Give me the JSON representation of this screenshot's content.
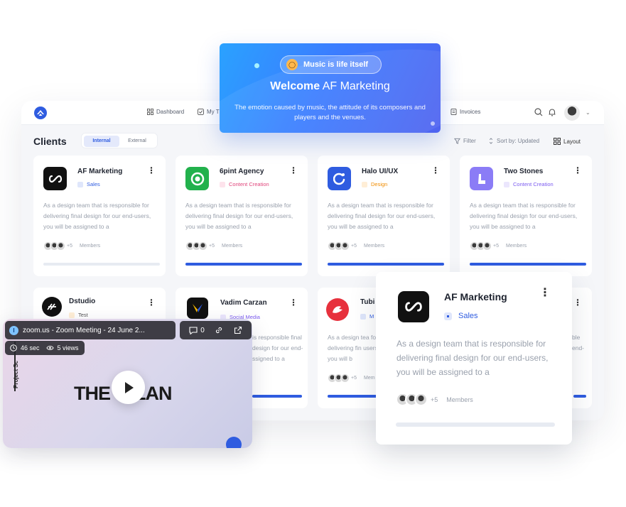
{
  "banner": {
    "pill_label": "Music is life itself",
    "title_bold": "Welcome",
    "title_rest": "AF Marketing",
    "subtitle": "The emotion caused by music, the attitude of its composers and players and the venues."
  },
  "topbar": {
    "nav": [
      "Dashboard",
      "My T",
      "Invoices"
    ],
    "icons": [
      "search-icon",
      "bell-icon"
    ]
  },
  "clients": {
    "title": "Clients",
    "segments": [
      "Internal",
      "External"
    ],
    "active_segment": "Internal",
    "filter_label": "Filter",
    "sort_label": "Sort by: Updated",
    "layout_label": "Layout"
  },
  "cards": [
    {
      "name": "AF Marketing",
      "tag": "Sales",
      "tag_color": "#2f5ce0",
      "icon_bg": "#111111",
      "desc": "As a design team that is responsible for delivering final design for our end-users, you will be assigned to a",
      "members_extra": "+5",
      "members_label": "Members",
      "progress": 0.0
    },
    {
      "name": "6pint Agency",
      "tag": "Content Creation",
      "tag_color": "#e0457b",
      "icon_bg": "#22b14c",
      "desc": "As a design team that is responsible for delivering final design for our end-users, you will be assigned to a",
      "members_extra": "+5",
      "members_label": "Members",
      "progress": 1.0
    },
    {
      "name": "Halo UI/UX",
      "tag": "Design",
      "tag_color": "#f08c00",
      "icon_bg": "#2f5ce0",
      "desc": "As a design team that is responsible for delivering final design for our end-users, you will be assigned to a",
      "members_extra": "+5",
      "members_label": "Members",
      "progress": 1.0
    },
    {
      "name": "Two Stones",
      "tag": "Content Creation",
      "tag_color": "#7c5cf0",
      "icon_bg": "#8b7cf6",
      "desc": "As a design team that is responsible for delivering final design for our end-users, you will be assigned to a",
      "members_extra": "+5",
      "members_label": "Members",
      "progress": 1.0
    },
    {
      "name": "Dstudio",
      "tag": "Test",
      "tag_color": "#f08c00",
      "icon_bg": "#111111",
      "desc": "",
      "members_extra": "",
      "members_label": "",
      "progress": 0.0
    },
    {
      "name": "Vadim Carzan",
      "tag": "Social Media",
      "tag_color": "#7c5cf0",
      "icon_bg": "#111111",
      "desc": "is responsible final design for our end-ssigned to a",
      "members_extra": "",
      "members_label": "",
      "progress": 1.0
    },
    {
      "name": "Tubi",
      "tag": "M",
      "tag_color": "#2f5ce0",
      "icon_bg": "#ffffff",
      "desc": "As a design tea for delivering fin users, you will b",
      "members_extra": "+5",
      "members_label": "Mem",
      "progress": 1.0
    },
    {
      "name": "",
      "tag": "",
      "tag_color": "#2f5ce0",
      "icon_bg": "#ffffff",
      "desc": "ble end-",
      "members_extra": "",
      "members_label": "",
      "progress": 1.0
    }
  ],
  "zoom": {
    "title": "zoom.us - Zoom Meeting - 24 June 2...",
    "comments": "0",
    "duration": "46 sec",
    "views": "5 views",
    "side_label": "Project Sc",
    "video_text_left": "THE",
    "video_text_right": "LAN"
  },
  "bigcard": {
    "name": "AF Marketing",
    "tag": "Sales",
    "desc": "As a design team that is responsible for delivering final design for our end-users, you will be assigned to a",
    "members_extra": "+5",
    "members_label": "Members",
    "progress": 0.0
  }
}
